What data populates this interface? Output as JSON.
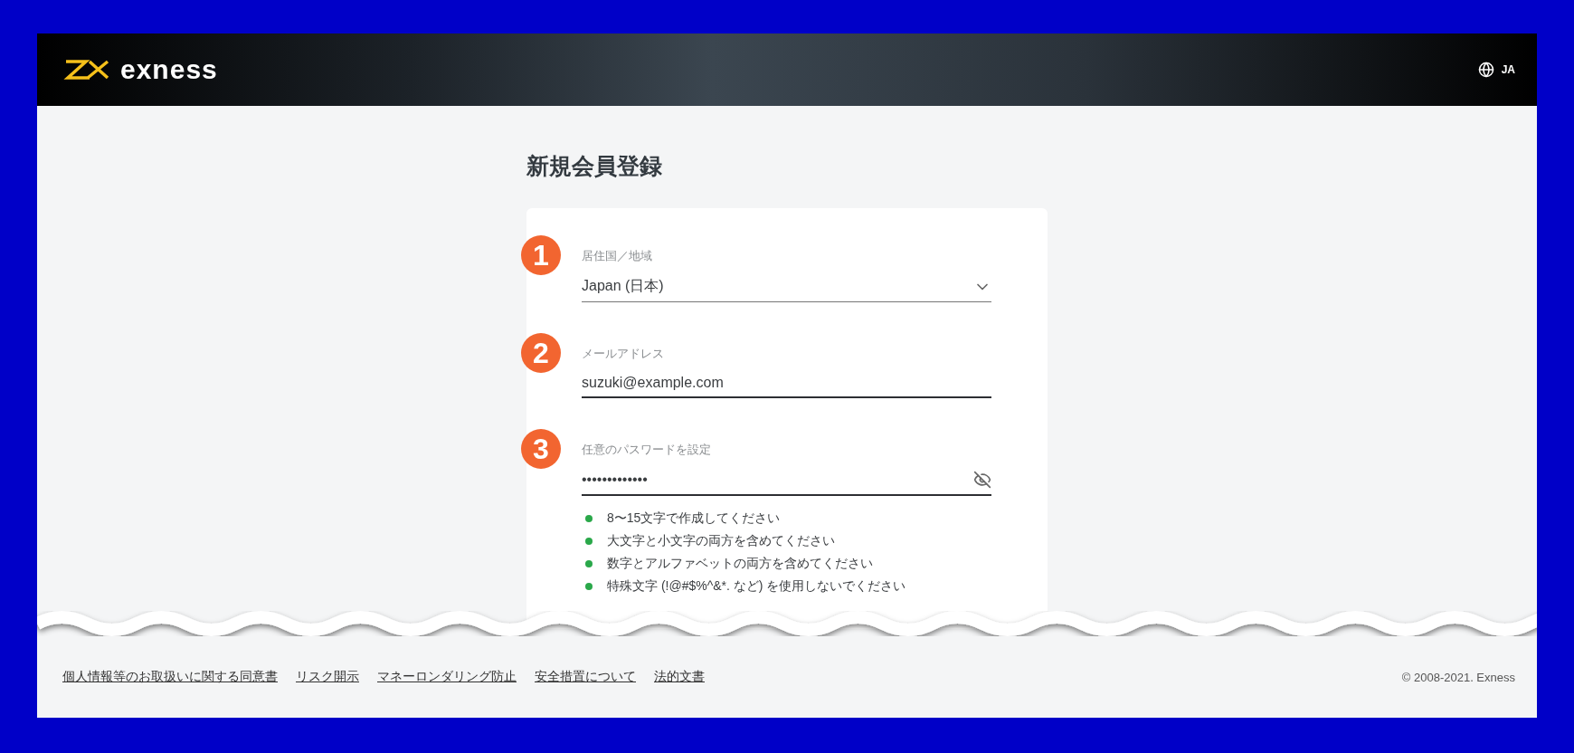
{
  "header": {
    "logo_text": "exness",
    "language": "JA"
  },
  "title": "新規会員登録",
  "fields": [
    {
      "kind": "select",
      "badge": "1",
      "label": "居住国／地域",
      "value": "Japan (日本)"
    },
    {
      "kind": "text",
      "badge": "2",
      "label": "メールアドレス",
      "value": "suzuki@example.com"
    },
    {
      "kind": "password",
      "badge": "3",
      "label": "任意のパスワードを設定",
      "value": "•••••••••••••"
    }
  ],
  "password_rules": [
    {
      "text": "8〜15文字で作成してください",
      "met": true
    },
    {
      "text": "大文字と小文字の両方を含めてください",
      "met": true
    },
    {
      "text": "数字とアルファベットの両方を含めてください",
      "met": true
    },
    {
      "text": "特殊文字 (!@#$%^&*. など) を使用しないでください",
      "met": true
    }
  ],
  "footer": {
    "links": [
      "個人情報等のお取扱いに関する同意書",
      "リスク開示",
      "マネーロンダリング防止",
      "安全措置について",
      "法的文書"
    ],
    "copyright": "© 2008-2021. Exness"
  }
}
